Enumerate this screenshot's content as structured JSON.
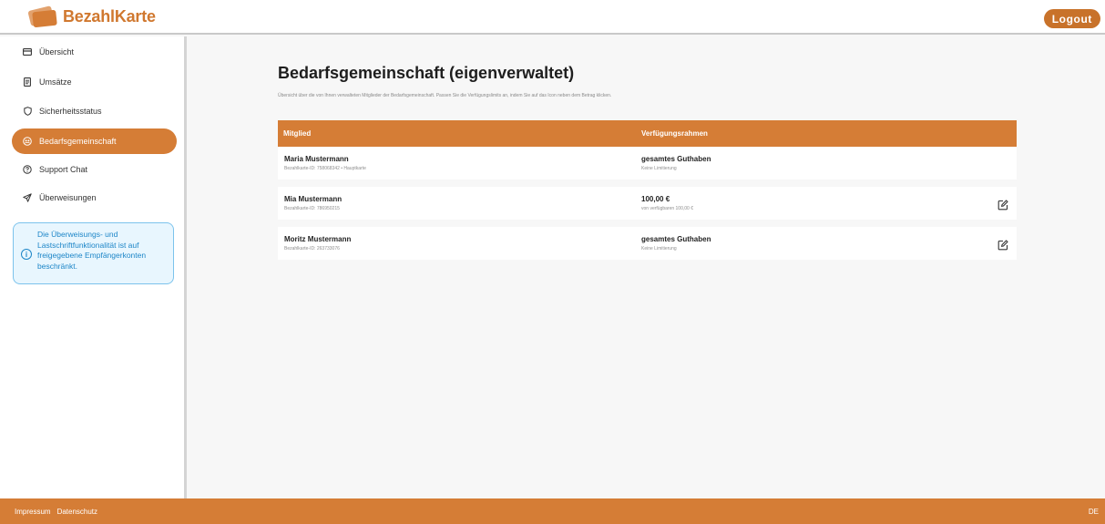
{
  "header": {
    "brand": "BezahlKarte",
    "logout_label": "Logout"
  },
  "sidebar": {
    "items": [
      {
        "label": "Übersicht",
        "icon": "card-icon"
      },
      {
        "label": "Umsätze",
        "icon": "receipt-icon"
      },
      {
        "label": "Sicherheitsstatus",
        "icon": "shield-icon"
      },
      {
        "label": "Bedarfsgemeinschaft",
        "icon": "group-icon",
        "active": true
      },
      {
        "label": "Support Chat",
        "icon": "help-icon"
      },
      {
        "label": "Überweisungen",
        "icon": "send-icon"
      }
    ],
    "info_text": "Die Überweisungs- und Lastschriftfunktionalität ist auf freigegebene Empfängerkonten beschränkt."
  },
  "main": {
    "title": "Bedarfsgemeinschaft (eigenverwaltet)",
    "description": "Übersicht über die von Ihnen verwalteten Mitglieder der Bedarfsgemeinschaft. Passen Sie die Verfügungslimits an, indem Sie auf das Icon neben dem Betrag klicken.",
    "table": {
      "headers": [
        "Mitglied",
        "Verfügungsrahmen"
      ],
      "rows": [
        {
          "name": "Maria Mustermann",
          "card_info": "Bezahlkarte-ID: 758068342 • Hauptkarte",
          "limit": "gesamtes Guthaben",
          "limit_sub": "Keine Limitierung",
          "editable": false
        },
        {
          "name": "Mia Mustermann",
          "card_info": "Bezahlkarte-ID: 786950215",
          "limit": "100,00 €",
          "limit_sub": "von verfügbaren 100,00 €",
          "editable": true
        },
        {
          "name": "Moritz Mustermann",
          "card_info": "Bezahlkarte-ID: 263733076",
          "limit": "gesamtes Guthaben",
          "limit_sub": "Keine Limitierung",
          "editable": true
        }
      ]
    }
  },
  "footer": {
    "impressum": "Impressum",
    "datenschutz": "Datenschutz",
    "language": "DE"
  },
  "colors": {
    "accent": "#d57d36",
    "info": "#1d86c8"
  }
}
